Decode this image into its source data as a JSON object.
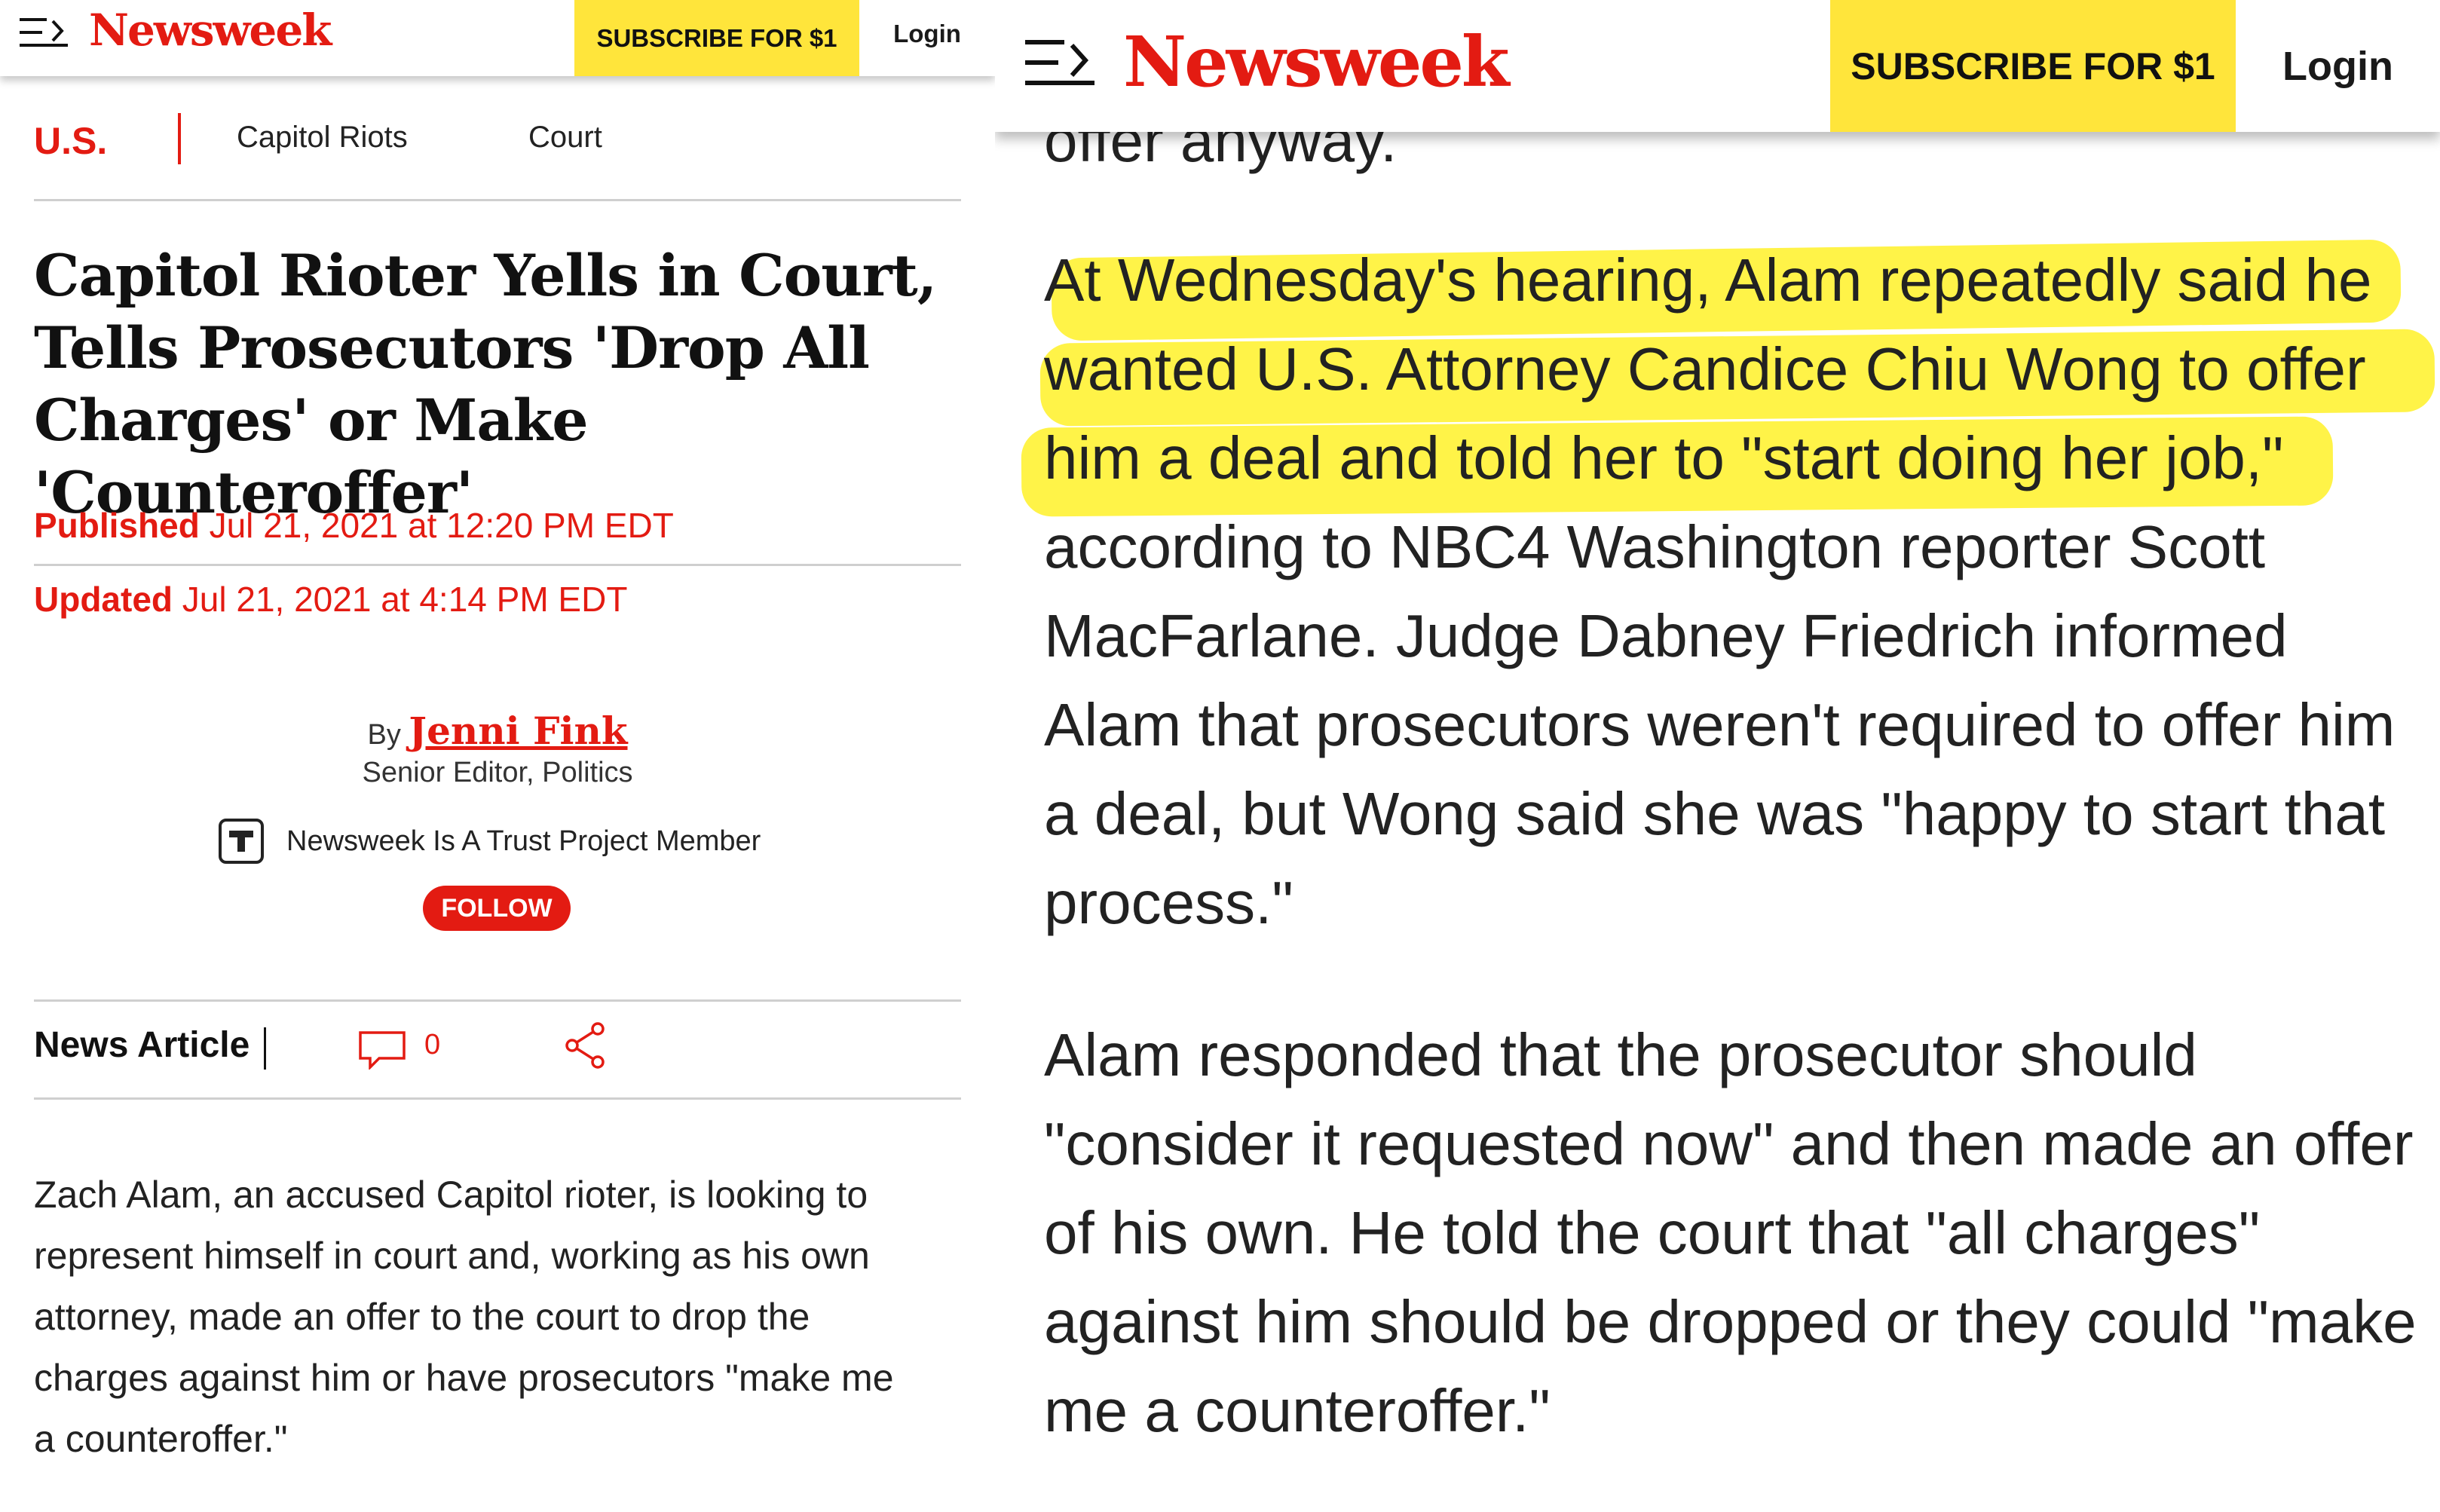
{
  "left": {
    "header": {
      "logo": "Newsweek",
      "subscribe_label": "SUBSCRIBE FOR $1",
      "login_label": "Login"
    },
    "nav": {
      "section": "U.S.",
      "items": [
        "Capitol Riots",
        "Court"
      ]
    },
    "article": {
      "headline": "Capitol Rioter Yells in Court, Tells Prosecutors 'Drop All Charges' or Make 'Counteroffer'",
      "published_label": "Published",
      "published_value": "Jul 21, 2021 at 12:20 PM EDT",
      "updated_label": "Updated",
      "updated_value": "Jul 21, 2021 at 4:14 PM EDT",
      "by_label": "By",
      "author": "Jenni Fink",
      "author_role": "Senior Editor, Politics",
      "trust_text": "Newsweek Is A Trust Project Member",
      "follow_label": "FOLLOW",
      "type_label": "News Article",
      "comment_count": "0",
      "body_lines": [
        "Zach Alam, an accused Capitol rioter, is looking to",
        "represent himself in court and, working as his own",
        "attorney, made an offer to the court to drop the",
        "charges against him or have prosecutors \"make me",
        "a counteroffer.\""
      ]
    }
  },
  "right": {
    "header": {
      "logo": "Newsweek",
      "subscribe_label": "SUBSCRIBE FOR $1",
      "login_label": "Login"
    },
    "partial_text": "offer anyway.",
    "paragraph1_lines": [
      "At Wednesday's hearing, Alam repeatedly said he",
      "wanted U.S. Attorney Candice Chiu Wong to offer",
      "him a deal and told her to \"start doing her job,\"",
      "according to NBC4 Washington reporter Scott",
      "MacFarlane. Judge Dabney Friedrich informed",
      "Alam that prosecutors weren't required to offer him",
      "a deal, but Wong said she was \"happy to start that",
      "process.\""
    ],
    "paragraph2_lines": [
      "Alam responded that the prosecutor should",
      "\"consider it requested now\" and then made an offer",
      "of his own. He told the court that \"all charges\"",
      "against him should be dropped or they could \"make",
      "me a counteroffer.\""
    ],
    "highlight_color": "#fff23e"
  },
  "colors": {
    "brand_red": "#e31b12",
    "subscribe_yellow": "#ffe53b"
  }
}
